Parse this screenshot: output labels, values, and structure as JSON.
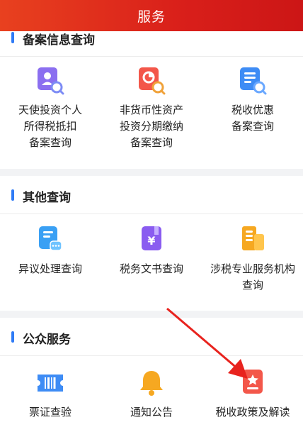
{
  "header": {
    "title": "服务"
  },
  "sections": [
    {
      "title": "备案信息查询",
      "items": [
        {
          "label": "天使投资个人\n所得税抵扣\n备案查询",
          "icon": "person-search-icon"
        },
        {
          "label": "非货币性资产\n投资分期缴纳\n备案查询",
          "icon": "pie-chart-search-icon"
        },
        {
          "label": "税收优惠\n备案查询",
          "icon": "document-search-icon"
        }
      ]
    },
    {
      "title": "其他查询",
      "items": [
        {
          "label": "异议处理查询",
          "icon": "chat-document-icon"
        },
        {
          "label": "税务文书查询",
          "icon": "yuan-document-icon"
        },
        {
          "label": "涉税专业服务机构\n查询",
          "icon": "building-icon"
        }
      ]
    },
    {
      "title": "公众服务",
      "items": [
        {
          "label": "票证查验",
          "icon": "ticket-barcode-icon"
        },
        {
          "label": "通知公告",
          "icon": "bell-icon"
        },
        {
          "label": "税收政策及解读",
          "icon": "star-document-icon"
        }
      ]
    }
  ],
  "colors": {
    "header": "#d91f1a",
    "accent_bar": "#2f7bf6",
    "arrow": "#e8231e"
  }
}
